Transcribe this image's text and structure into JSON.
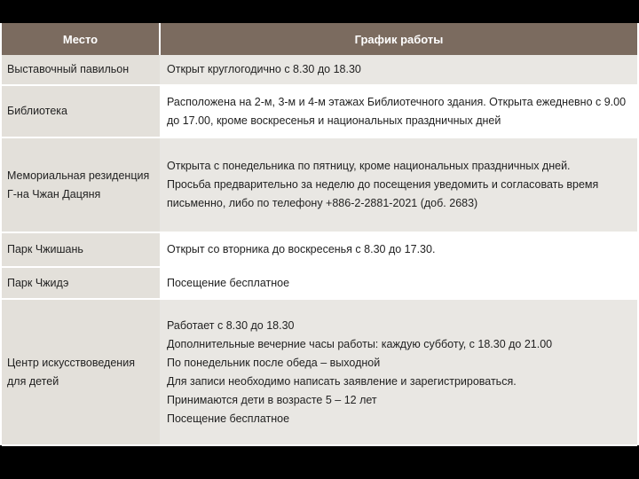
{
  "table": {
    "headers": [
      "Место",
      "График работы"
    ],
    "rows": [
      {
        "place": "Выставочный павильон",
        "schedule": [
          "Открыт круглогодично с 8.30 до 18.30"
        ]
      },
      {
        "place": "Библиотека",
        "schedule": [
          "Расположена на 2-м, 3-м и 4-м этажах Библиотечного здания. Открыта ежедневно с 9.00",
          "до 17.00, кроме воскресенья и национальных праздничных дней"
        ]
      },
      {
        "place": "Мемориальная резиденция Г-на Чжан Дацяня",
        "schedule": [
          "Открыта с понедельника по пятницу, кроме национальных праздничных дней.",
          "Просьба предварительно за неделю до посещения уведомить и согласовать время",
          "письменно, либо по телефону +886-2-2881-2021 (доб. 2683)"
        ]
      },
      {
        "place": "Парк Чжишань",
        "schedule": [
          "Открыт со вторника до воскресенья с 8.30 до 17.30."
        ]
      },
      {
        "place": "Парк Чжидэ",
        "schedule": [
          "Посещение бесплатное"
        ]
      },
      {
        "place": "Центр искусствоведения для детей",
        "schedule": [
          "Работает с 8.30 до 18.30",
          "Дополнительные вечерние часы работы: каждую субботу, с 18.30 до 21.00",
          "По понедельник после обеда – выходной",
          "Для записи необходимо написать заявление и зарегистрироваться.",
          "Принимаются дети в возрасте 5 – 12 лет",
          "Посещение бесплатное"
        ]
      }
    ]
  }
}
